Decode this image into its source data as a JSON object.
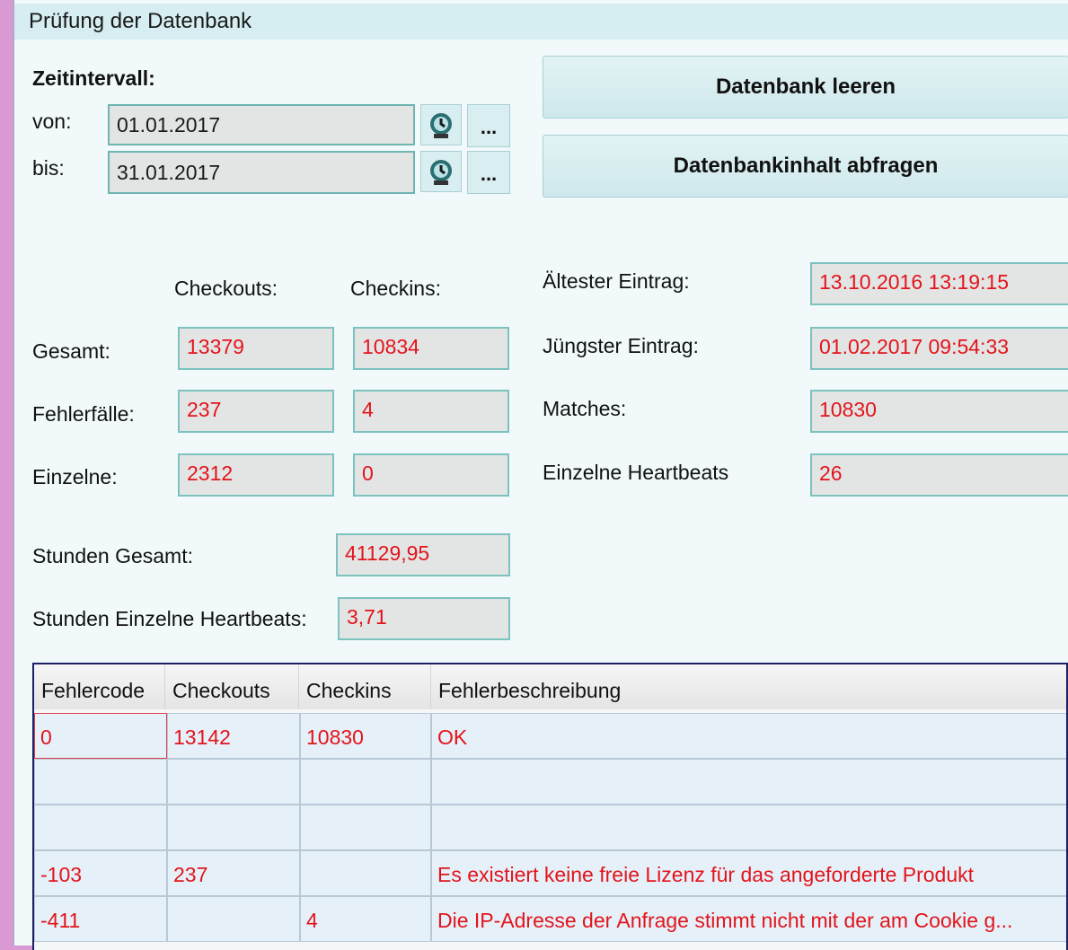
{
  "window": {
    "title": "Prüfung der Datenbank"
  },
  "interval": {
    "heading": "Zeitintervall:",
    "from_label": "von:",
    "from_value": "01.01.2017",
    "to_label": "bis:",
    "to_value": "31.01.2017",
    "picker_icon": "calendar-picker-icon",
    "ellipsis_label": "..."
  },
  "buttons": {
    "clear": "Datenbank leeren",
    "query": "Datenbankinhalt abfragen"
  },
  "stats": {
    "col_checkouts": "Checkouts:",
    "col_checkins": "Checkins:",
    "total_label": "Gesamt:",
    "total_checkouts": "13379",
    "total_checkins": "10834",
    "errors_label": "Fehlerfälle:",
    "errors_checkouts": "237",
    "errors_checkins": "4",
    "single_label": "Einzelne:",
    "single_checkouts": "2312",
    "single_checkins": "0",
    "hours_total_label": "Stunden Gesamt:",
    "hours_total": "41129,95",
    "hours_hb_label": "Stunden Einzelne Heartbeats:",
    "hours_hb": "3,71"
  },
  "right": {
    "oldest_label": "Ältester Eintrag:",
    "oldest_value": "13.10.2016 13:19:15",
    "newest_label": "Jüngster Eintrag:",
    "newest_value": "01.02.2017 09:54:33",
    "matches_label": "Matches:",
    "matches_value": "10830",
    "heartbeats_label": "Einzelne Heartbeats",
    "heartbeats_value": "26"
  },
  "table": {
    "headers": [
      "Fehlercode",
      "Checkouts",
      "Checkins",
      "Fehlerbeschreibung"
    ],
    "rows": [
      [
        "0",
        "13142",
        "10830",
        "OK"
      ],
      [
        "",
        "",
        "",
        ""
      ],
      [
        "",
        "",
        "",
        ""
      ],
      [
        "-103",
        "237",
        "",
        "Es existiert keine freie Lizenz für das angeforderte Produkt"
      ],
      [
        "-411",
        "",
        "4",
        "Die IP-Adresse der Anfrage stimmt nicht mit der am Cookie g..."
      ]
    ]
  },
  "colors": {
    "value_red": "#e3141b",
    "field_border": "#7cc3bf",
    "window_bg": "#f1f9fb",
    "grid_border": "#1a1f66"
  }
}
